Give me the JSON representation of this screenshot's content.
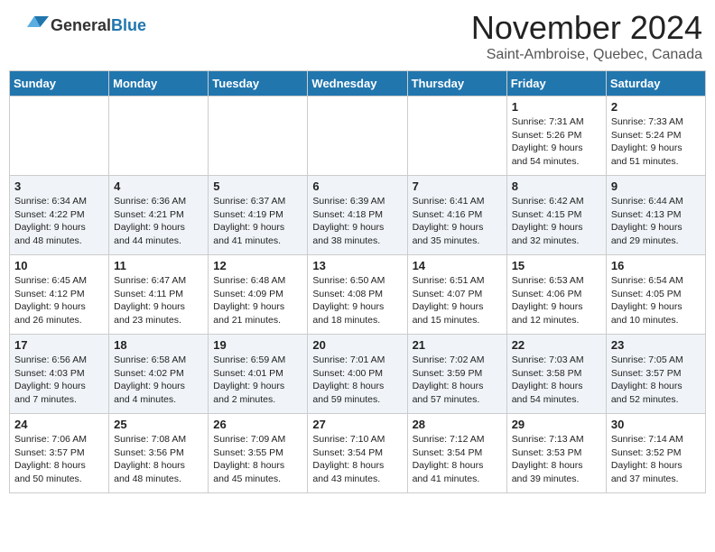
{
  "header": {
    "logo": {
      "general": "General",
      "blue": "Blue"
    },
    "month": "November 2024",
    "location": "Saint-Ambroise, Quebec, Canada"
  },
  "weekdays": [
    "Sunday",
    "Monday",
    "Tuesday",
    "Wednesday",
    "Thursday",
    "Friday",
    "Saturday"
  ],
  "weeks": [
    [
      {
        "day": "",
        "info": ""
      },
      {
        "day": "",
        "info": ""
      },
      {
        "day": "",
        "info": ""
      },
      {
        "day": "",
        "info": ""
      },
      {
        "day": "",
        "info": ""
      },
      {
        "day": "1",
        "info": "Sunrise: 7:31 AM\nSunset: 5:26 PM\nDaylight: 9 hours\nand 54 minutes."
      },
      {
        "day": "2",
        "info": "Sunrise: 7:33 AM\nSunset: 5:24 PM\nDaylight: 9 hours\nand 51 minutes."
      }
    ],
    [
      {
        "day": "3",
        "info": "Sunrise: 6:34 AM\nSunset: 4:22 PM\nDaylight: 9 hours\nand 48 minutes."
      },
      {
        "day": "4",
        "info": "Sunrise: 6:36 AM\nSunset: 4:21 PM\nDaylight: 9 hours\nand 44 minutes."
      },
      {
        "day": "5",
        "info": "Sunrise: 6:37 AM\nSunset: 4:19 PM\nDaylight: 9 hours\nand 41 minutes."
      },
      {
        "day": "6",
        "info": "Sunrise: 6:39 AM\nSunset: 4:18 PM\nDaylight: 9 hours\nand 38 minutes."
      },
      {
        "day": "7",
        "info": "Sunrise: 6:41 AM\nSunset: 4:16 PM\nDaylight: 9 hours\nand 35 minutes."
      },
      {
        "day": "8",
        "info": "Sunrise: 6:42 AM\nSunset: 4:15 PM\nDaylight: 9 hours\nand 32 minutes."
      },
      {
        "day": "9",
        "info": "Sunrise: 6:44 AM\nSunset: 4:13 PM\nDaylight: 9 hours\nand 29 minutes."
      }
    ],
    [
      {
        "day": "10",
        "info": "Sunrise: 6:45 AM\nSunset: 4:12 PM\nDaylight: 9 hours\nand 26 minutes."
      },
      {
        "day": "11",
        "info": "Sunrise: 6:47 AM\nSunset: 4:11 PM\nDaylight: 9 hours\nand 23 minutes."
      },
      {
        "day": "12",
        "info": "Sunrise: 6:48 AM\nSunset: 4:09 PM\nDaylight: 9 hours\nand 21 minutes."
      },
      {
        "day": "13",
        "info": "Sunrise: 6:50 AM\nSunset: 4:08 PM\nDaylight: 9 hours\nand 18 minutes."
      },
      {
        "day": "14",
        "info": "Sunrise: 6:51 AM\nSunset: 4:07 PM\nDaylight: 9 hours\nand 15 minutes."
      },
      {
        "day": "15",
        "info": "Sunrise: 6:53 AM\nSunset: 4:06 PM\nDaylight: 9 hours\nand 12 minutes."
      },
      {
        "day": "16",
        "info": "Sunrise: 6:54 AM\nSunset: 4:05 PM\nDaylight: 9 hours\nand 10 minutes."
      }
    ],
    [
      {
        "day": "17",
        "info": "Sunrise: 6:56 AM\nSunset: 4:03 PM\nDaylight: 9 hours\nand 7 minutes."
      },
      {
        "day": "18",
        "info": "Sunrise: 6:58 AM\nSunset: 4:02 PM\nDaylight: 9 hours\nand 4 minutes."
      },
      {
        "day": "19",
        "info": "Sunrise: 6:59 AM\nSunset: 4:01 PM\nDaylight: 9 hours\nand 2 minutes."
      },
      {
        "day": "20",
        "info": "Sunrise: 7:01 AM\nSunset: 4:00 PM\nDaylight: 8 hours\nand 59 minutes."
      },
      {
        "day": "21",
        "info": "Sunrise: 7:02 AM\nSunset: 3:59 PM\nDaylight: 8 hours\nand 57 minutes."
      },
      {
        "day": "22",
        "info": "Sunrise: 7:03 AM\nSunset: 3:58 PM\nDaylight: 8 hours\nand 54 minutes."
      },
      {
        "day": "23",
        "info": "Sunrise: 7:05 AM\nSunset: 3:57 PM\nDaylight: 8 hours\nand 52 minutes."
      }
    ],
    [
      {
        "day": "24",
        "info": "Sunrise: 7:06 AM\nSunset: 3:57 PM\nDaylight: 8 hours\nand 50 minutes."
      },
      {
        "day": "25",
        "info": "Sunrise: 7:08 AM\nSunset: 3:56 PM\nDaylight: 8 hours\nand 48 minutes."
      },
      {
        "day": "26",
        "info": "Sunrise: 7:09 AM\nSunset: 3:55 PM\nDaylight: 8 hours\nand 45 minutes."
      },
      {
        "day": "27",
        "info": "Sunrise: 7:10 AM\nSunset: 3:54 PM\nDaylight: 8 hours\nand 43 minutes."
      },
      {
        "day": "28",
        "info": "Sunrise: 7:12 AM\nSunset: 3:54 PM\nDaylight: 8 hours\nand 41 minutes."
      },
      {
        "day": "29",
        "info": "Sunrise: 7:13 AM\nSunset: 3:53 PM\nDaylight: 8 hours\nand 39 minutes."
      },
      {
        "day": "30",
        "info": "Sunrise: 7:14 AM\nSunset: 3:52 PM\nDaylight: 8 hours\nand 37 minutes."
      }
    ]
  ]
}
